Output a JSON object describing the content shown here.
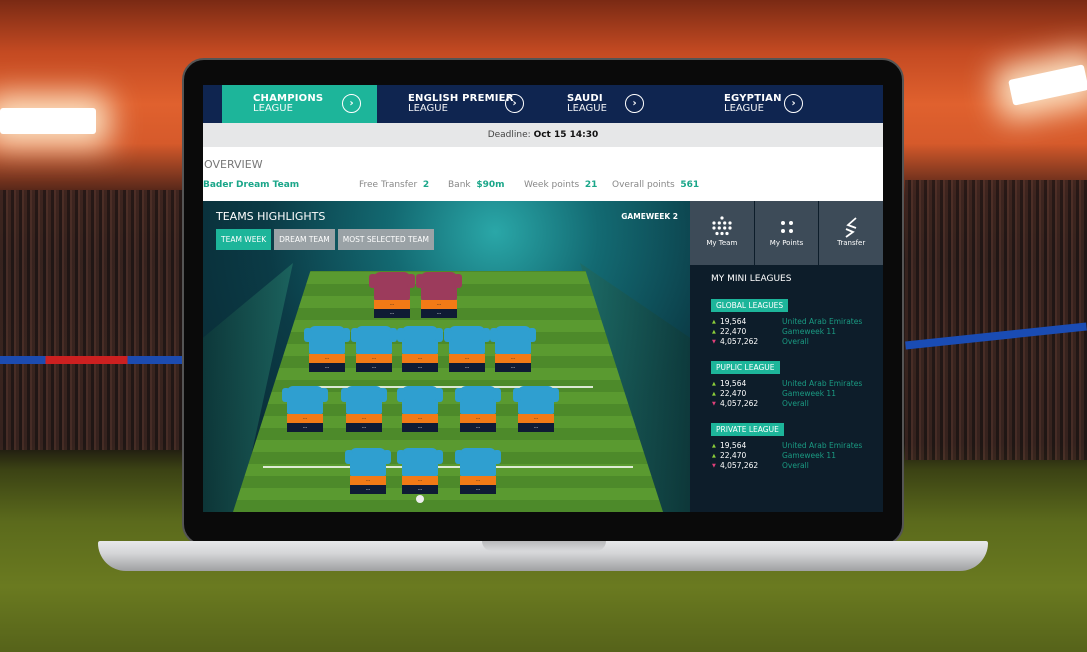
{
  "nav": {
    "tabs": [
      {
        "line1": "CHAMPIONS",
        "line2": "LEAGUE",
        "active": true,
        "icon": "chevron-right-circle-icon"
      },
      {
        "line1": "ENGLISH PREMIER",
        "line2": "LEAGUE",
        "active": false,
        "icon": "chevron-right-circle-icon"
      },
      {
        "line1": "SAUDI",
        "line2": "LEAGUE",
        "active": false,
        "icon": "chevron-right-circle-icon"
      },
      {
        "line1": "EGYPTIAN",
        "line2": "LEAGUE",
        "active": false,
        "icon": "chevron-right-circle-icon"
      }
    ],
    "arrow_glyph": "›"
  },
  "deadline": {
    "label": "Deadline:",
    "value": "Oct 15 14:30"
  },
  "overview": {
    "title": "OVERVIEW",
    "team_name": "Bader Dream Team",
    "stats": [
      {
        "label": "Free Transfer",
        "value": "2"
      },
      {
        "label": "Bank",
        "value": "$90m"
      },
      {
        "label": "Week points",
        "value": "21"
      },
      {
        "label": "Overall points",
        "value": "561"
      }
    ]
  },
  "highlights": {
    "title": "TEAMS HIGHLIGHTS",
    "gameweek": "GAMEWEEK 2",
    "filters": [
      {
        "label": "TEAM WEEK",
        "active": true
      },
      {
        "label": "DREAM TEAM",
        "active": false
      },
      {
        "label": "MOST SELECTED TEAM",
        "active": false
      }
    ],
    "formation": {
      "goalkeepers": 2,
      "row2": 5,
      "row3": 5,
      "row4": 3
    },
    "player_name_placeholder": "---",
    "player_points_placeholder": "---"
  },
  "actions": [
    {
      "label": "My Team",
      "icon": "formation-dots-icon"
    },
    {
      "label": "My Points",
      "icon": "four-dots-icon"
    },
    {
      "label": "Transfer",
      "icon": "transfer-arrows-icon"
    }
  ],
  "mini_leagues": {
    "title": "MY MINI LEAGUES",
    "groups": [
      {
        "name": "GLOBAL LEAGUES",
        "rows": [
          {
            "trend": "up",
            "value": "19,564",
            "label": "United Arab Emirates"
          },
          {
            "trend": "up",
            "value": "22,470",
            "label": "Gameweek 11"
          },
          {
            "trend": "down",
            "value": "4,057,262",
            "label": "Overall"
          }
        ]
      },
      {
        "name": "PUPLIC LEAGUE",
        "rows": [
          {
            "trend": "up",
            "value": "19,564",
            "label": "United Arab Emirates"
          },
          {
            "trend": "up",
            "value": "22,470",
            "label": "Gameweek 11"
          },
          {
            "trend": "down",
            "value": "4,057,262",
            "label": "Overall"
          }
        ]
      },
      {
        "name": "PRIVATE LEAGUE",
        "rows": [
          {
            "trend": "up",
            "value": "19,564",
            "label": "United Arab Emirates"
          },
          {
            "trend": "up",
            "value": "22,470",
            "label": "Gameweek 11"
          },
          {
            "trend": "down",
            "value": "4,057,262",
            "label": "Overall"
          }
        ]
      }
    ]
  },
  "colors": {
    "accent": "#1db59a",
    "nav_bg": "#0f2550",
    "name_bar": "#f27a16",
    "points_bar": "#0f1b34"
  }
}
